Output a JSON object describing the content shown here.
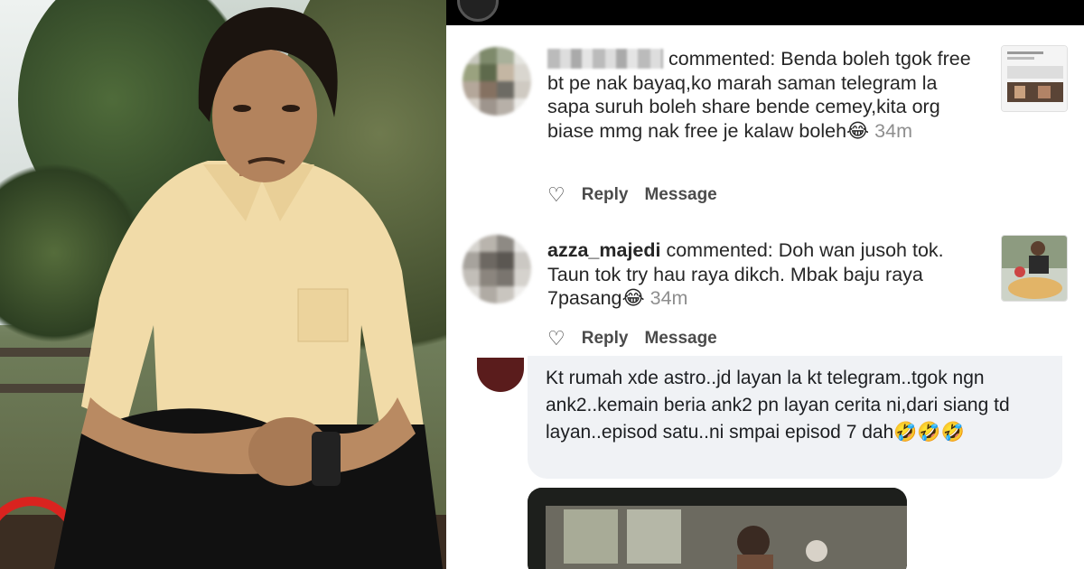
{
  "notifications": [
    {
      "username": "",
      "action": "commented:",
      "text": "Benda boleh tgok free bt pe nak bayaq,ko marah saman telegram la sapa suruh boleh share bende cemey,kita org biase mmg nak free je kalaw boleh😂",
      "time": "34m",
      "reply_label": "Reply",
      "message_label": "Message"
    },
    {
      "username": "azza_majedi",
      "action": "commented:",
      "text": "Doh wan jusoh tok. Taun tok try hau raya dikch. Mbak baju raya 7pasang😂",
      "time": "34m",
      "reply_label": "Reply",
      "message_label": "Message"
    }
  ],
  "fb_comment": {
    "text": "Kt rumah xde astro..jd layan la kt telegram..tgok ngn ank2..kemain beria ank2 pn layan cerita ni,dari siang td layan..episod satu..ni smpai episod 7 dah🤣🤣🤣"
  },
  "icons": {
    "heart": "heart-outline-icon"
  },
  "colors": {
    "topbar": "#000000",
    "text": "#262626",
    "muted": "#8e8e8e",
    "fb_bubble": "#f0f2f5"
  }
}
